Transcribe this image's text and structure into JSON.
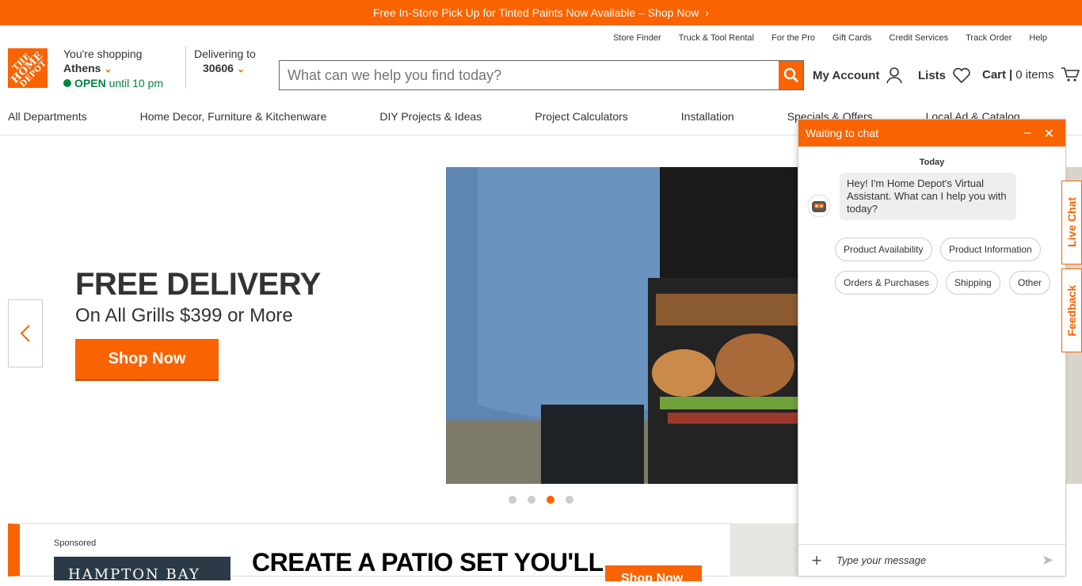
{
  "promo": {
    "text": "Free In-Store Pick Up for Tinted Paints Now Available – Shop Now",
    "chevron": "›"
  },
  "util_nav": [
    "Store Finder",
    "Truck & Tool Rental",
    "For the Pro",
    "Gift Cards",
    "Credit Services",
    "Track Order",
    "Help"
  ],
  "logo": {
    "l1": "THE",
    "l2": "HOME",
    "l3": "DEPOT"
  },
  "store": {
    "label": "You're shopping",
    "city": "Athens",
    "open": "OPEN",
    "hours": "until 10 pm"
  },
  "delivery": {
    "label": "Delivering to",
    "zip": "30606"
  },
  "search": {
    "placeholder": "What can we help you find today?"
  },
  "account": {
    "my_account": "My Account",
    "lists": "Lists",
    "cart": "Cart",
    "cart_sep": "|",
    "cart_count": "0 items"
  },
  "main_nav": [
    "All Departments",
    "Home Decor, Furniture & Kitchenware",
    "DIY Projects & Ideas",
    "Project Calculators",
    "Installation",
    "Specials & Offers",
    "Local Ad & Catalog"
  ],
  "hero": {
    "title": "FREE DELIVERY",
    "subtitle": "On All Grills $399 or More",
    "button": "Shop Now",
    "prev": "‹",
    "active_slide": 3,
    "slide_count": 4
  },
  "sponsored": {
    "label": "Sponsored",
    "brand": "HAMPTON BAY",
    "headline": "CREATE A PATIO SET YOU'LL",
    "button": "Shop Now"
  },
  "chat": {
    "title": "Waiting to chat",
    "minimize": "–",
    "close": "✕",
    "day": "Today",
    "message": "Hey! I'm Home Depot's Virtual Assistant. What can I help you with today?",
    "chips": [
      "Product Availability",
      "Product Information",
      "Orders & Purchases",
      "Shipping",
      "Other"
    ],
    "input_placeholder": "Type your message",
    "plus": "+",
    "send": "➤"
  },
  "side_tabs": {
    "live_chat": "Live Chat",
    "feedback": "Feedback"
  },
  "colors": {
    "brand": "#f96302",
    "open_green": "#00853f"
  }
}
